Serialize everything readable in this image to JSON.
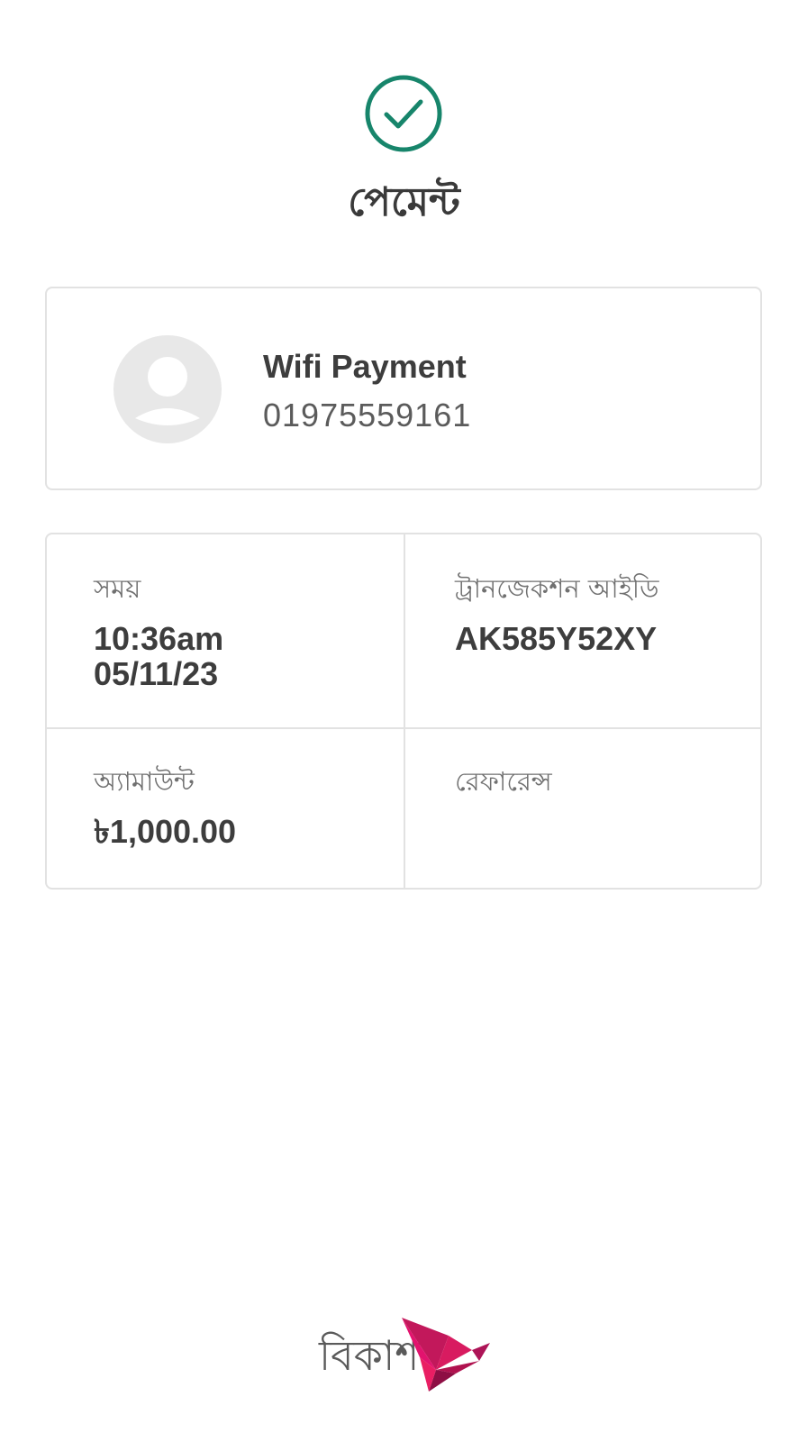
{
  "header": {
    "icon": "check-circle-icon",
    "title": "পেমেন্ট"
  },
  "recipient": {
    "avatar_icon": "person-avatar-icon",
    "name": "Wifi Payment",
    "number": "01975559161"
  },
  "details": {
    "time_label": "সময়",
    "time_value": "10:36am",
    "date_value": "05/11/23",
    "txid_label": "ট্রানজেকশন আইডি",
    "txid_value": "AK585Y52XY",
    "amount_label": "অ্যামাউন্ট",
    "amount_value": "৳1,000.00",
    "reference_label": "রেফারেন্স",
    "reference_value": ""
  },
  "brand": {
    "name": "বিকাশ",
    "logo_icon": "origami-bird-icon"
  },
  "colors": {
    "success": "#17856b",
    "brand_pink": "#e2136e",
    "card_border": "#e2e2e2"
  }
}
